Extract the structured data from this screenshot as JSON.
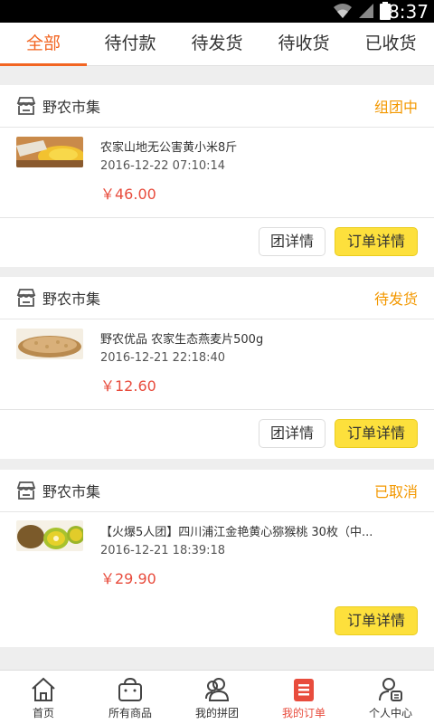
{
  "status_bar": {
    "time": "8:37"
  },
  "tabs": [
    {
      "label": "全部",
      "active": true
    },
    {
      "label": "待付款",
      "active": false
    },
    {
      "label": "待发货",
      "active": false
    },
    {
      "label": "待收货",
      "active": false
    },
    {
      "label": "已收货",
      "active": false
    }
  ],
  "orders": [
    {
      "store": "野农市集",
      "status": "组团中",
      "product": "农家山地无公害黄小米8斤",
      "time": "2016-12-22 07:10:14",
      "price": "￥46.00",
      "group_button": "团详情",
      "detail_button": "订单详情"
    },
    {
      "store": "野农市集",
      "status": "待发货",
      "product": "野农优品 农家生态燕麦片500g",
      "time": "2016-12-21 22:18:40",
      "price": "￥12.60",
      "group_button": "团详情",
      "detail_button": "订单详情"
    },
    {
      "store": "野农市集",
      "status": "已取消",
      "product": "【火爆5人团】四川浦江金艳黄心猕猴桃 30枚（中...",
      "time": "2016-12-21 18:39:18",
      "price": "￥29.90",
      "detail_button": "订单详情"
    }
  ],
  "bottom_nav": [
    {
      "label": "首页",
      "icon": "home-icon"
    },
    {
      "label": "所有商品",
      "icon": "shopping-bag-icon"
    },
    {
      "label": "我的拼团",
      "icon": "group-icon"
    },
    {
      "label": "我的订单",
      "icon": "order-list-icon",
      "active": true
    },
    {
      "label": "个人中心",
      "icon": "user-center-icon"
    }
  ],
  "colors": {
    "accent": "#f26522",
    "status": "#f39800",
    "price": "#e84c3d",
    "detail_button": "#fde03c"
  }
}
